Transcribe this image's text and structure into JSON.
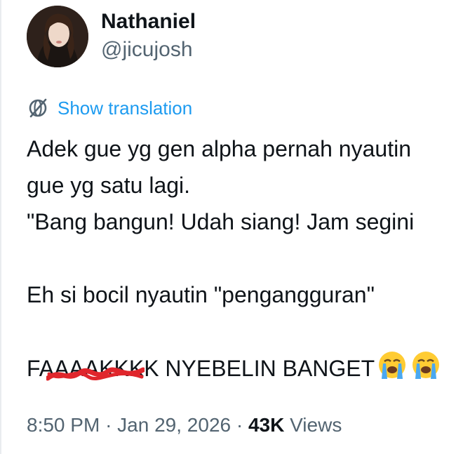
{
  "author": {
    "display_name": "Nathaniel",
    "handle": "@jicujosh"
  },
  "translate": {
    "label": "Show translation",
    "icon": "globe-slash-icon"
  },
  "tweet": {
    "lines": [
      "Adek gue yg gen alpha pernah nyautin",
      "gue yg satu lagi.",
      "\"Bang bangun! Udah siang! Jam segini",
      "",
      "Eh si bocil nyautin \"pengangguran\"",
      ""
    ],
    "last_line_prefix": "F",
    "last_line_struck": "AAAAKK",
    "last_line_rest": "KK NYEBELIN BANGET",
    "emojis": [
      "loudly-crying-face-icon",
      "loudly-crying-face-icon"
    ]
  },
  "meta": {
    "time": "8:50 PM",
    "separator": "·",
    "date": "Jan 29, 2026",
    "views_count": "43K",
    "views_label": "Views"
  },
  "colors": {
    "link": "#1d9bf0",
    "text": "#0f1419",
    "secondary": "#536471",
    "strike": "#e0262c"
  }
}
